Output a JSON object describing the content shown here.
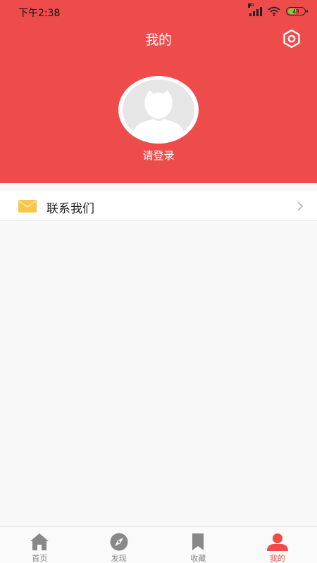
{
  "status": {
    "time": "下午2:38",
    "network": "HD",
    "battery": "49",
    "battery_level": 0.49
  },
  "header": {
    "title": "我的",
    "settings_icon": "settings-hexagon-icon",
    "login_label": "请登录"
  },
  "menu": {
    "items": [
      {
        "label": "联系我们",
        "icon": "mail-icon"
      }
    ]
  },
  "tabbar": {
    "tabs": [
      {
        "label": "首页",
        "icon": "home-icon"
      },
      {
        "label": "发现",
        "icon": "compass-icon"
      },
      {
        "label": "收藏",
        "icon": "bookmark-icon"
      },
      {
        "label": "我的",
        "icon": "user-icon",
        "active": true
      }
    ]
  },
  "colors": {
    "brand": "#ee4c4a",
    "mail": "#f7c64a",
    "inactive": "#888888"
  }
}
